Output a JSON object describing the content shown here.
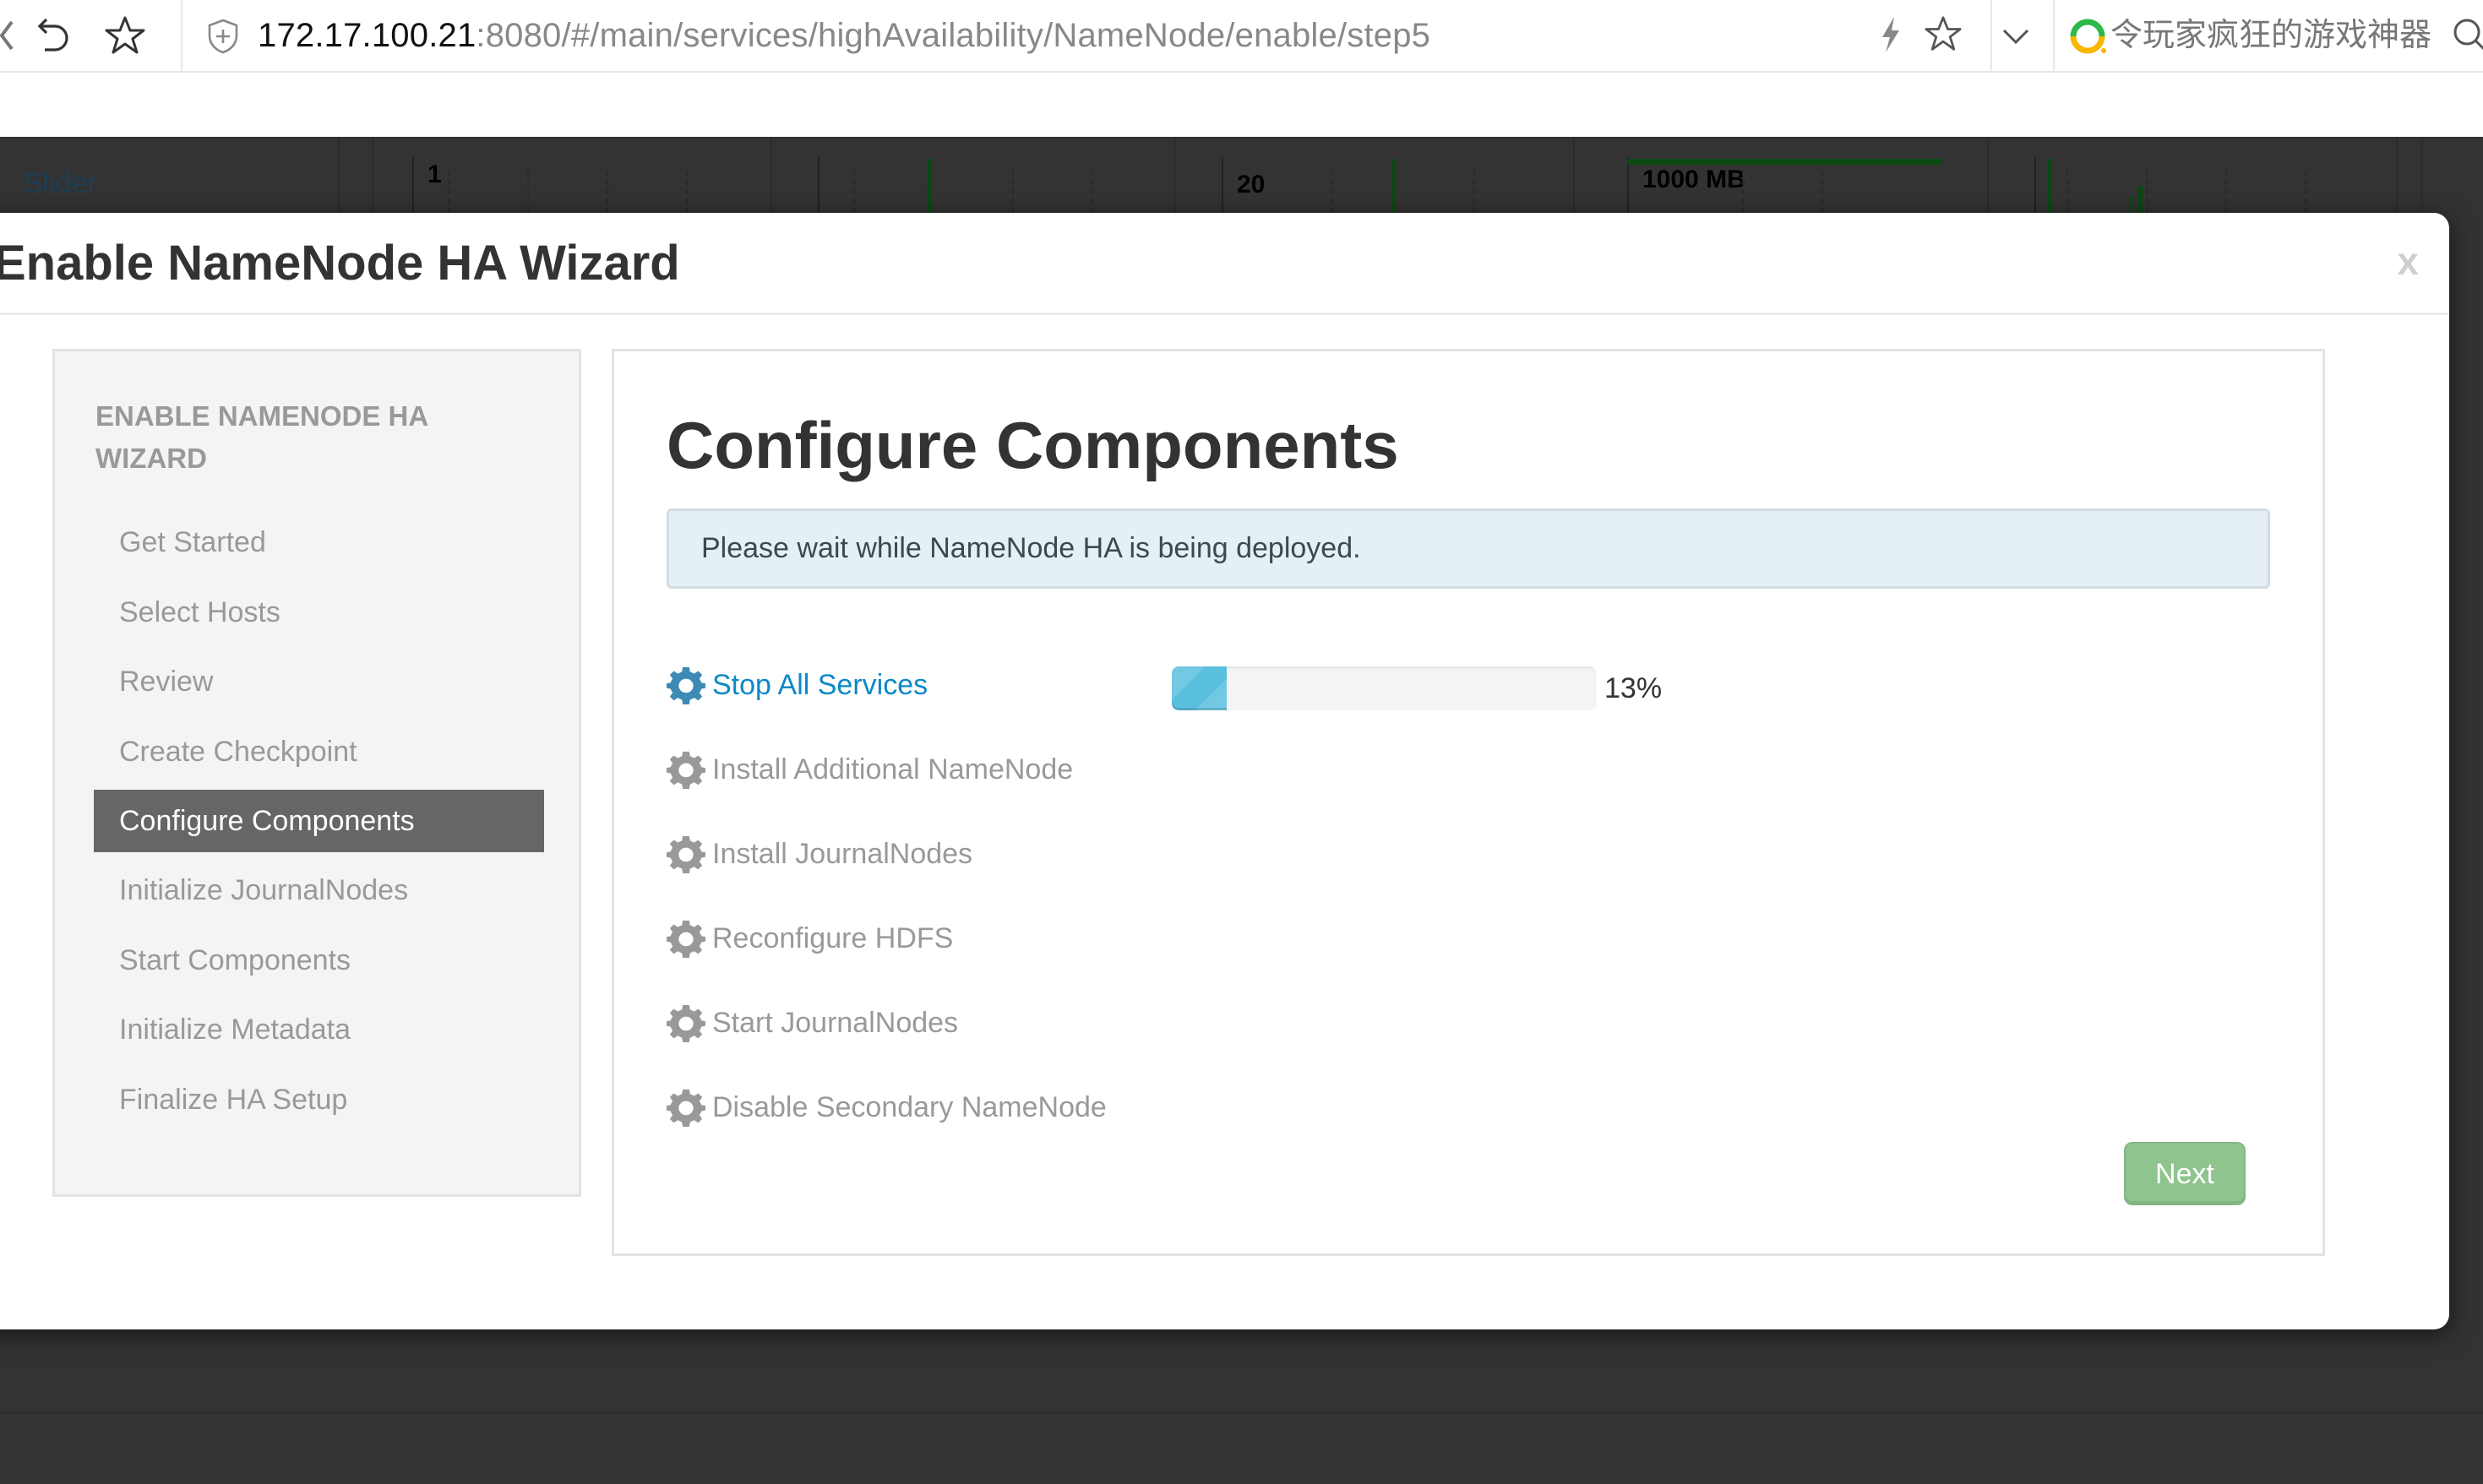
{
  "browser": {
    "url_host": "172.17.100.21",
    "url_rest": ":8080/#/main/services/highAvailability/NameNode/enable/step5",
    "search_hint": "令玩家疯狂的游戏神器",
    "icons": [
      "back-icon",
      "undo-icon",
      "star-icon",
      "shield-icon",
      "lightning-icon",
      "star-outline-icon",
      "chevron-down-icon",
      "search-engine-logo-icon",
      "search-icon"
    ]
  },
  "background": {
    "slider_link": "Slider",
    "widget_values": [
      "1",
      "20",
      "1000 MB"
    ]
  },
  "modal": {
    "title": "Enable NameNode HA Wizard",
    "close_label": "x"
  },
  "sidebar": {
    "heading": "ENABLE NAMENODE HA WIZARD",
    "steps": [
      {
        "label": "Get Started",
        "active": false
      },
      {
        "label": "Select Hosts",
        "active": false
      },
      {
        "label": "Review",
        "active": false
      },
      {
        "label": "Create Checkpoint",
        "active": false
      },
      {
        "label": "Configure Components",
        "active": true
      },
      {
        "label": "Initialize JournalNodes",
        "active": false
      },
      {
        "label": "Start Components",
        "active": false
      },
      {
        "label": "Initialize Metadata",
        "active": false
      },
      {
        "label": "Finalize HA Setup",
        "active": false
      }
    ]
  },
  "content": {
    "title": "Configure Components",
    "alert": "Please wait while NameNode HA is being deployed.",
    "tasks": [
      {
        "label": "Stop All Services",
        "status": "in_progress",
        "progress_percent": 13,
        "progress_label": "13%"
      },
      {
        "label": "Install Additional NameNode",
        "status": "pending"
      },
      {
        "label": "Install JournalNodes",
        "status": "pending"
      },
      {
        "label": "Reconfigure HDFS",
        "status": "pending"
      },
      {
        "label": "Start JournalNodes",
        "status": "pending"
      },
      {
        "label": "Disable Secondary NameNode",
        "status": "pending"
      }
    ],
    "next_label": "Next",
    "next_enabled": false
  },
  "colors": {
    "active_task": "#0b89c7",
    "progress_fill": "#5bc0de",
    "next_button": "#8fc48f",
    "active_step_bg": "#666666",
    "alert_bg": "#e5f0f5"
  }
}
